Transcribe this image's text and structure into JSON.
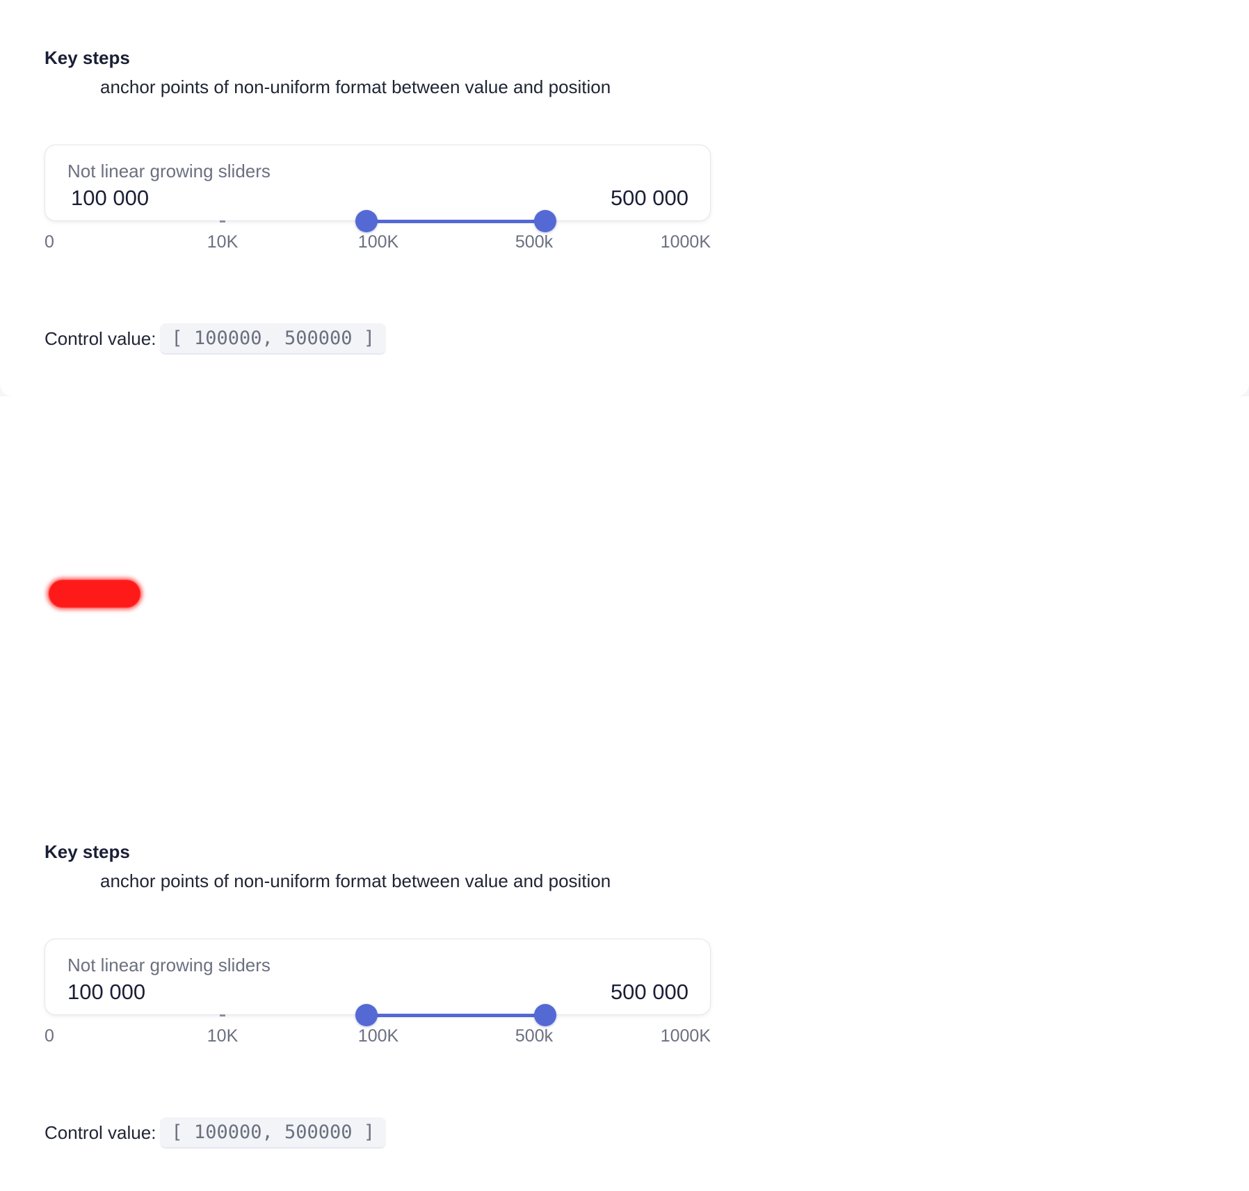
{
  "sections": [
    {
      "title": "Key steps",
      "subtitle": "anchor points of non-uniform format between value and position",
      "card_label": "Not linear growing sliders",
      "value_low": "100 000",
      "value_high": "500 000",
      "ticks": [
        "0",
        "10K",
        "100K",
        "500k",
        "1000K"
      ],
      "selected_range_tick_index": [
        2,
        3
      ],
      "control_label": "Control value:",
      "control_value": "[ 100000, 500000 ]"
    },
    {
      "title": "Key steps",
      "subtitle": "anchor points of non-uniform format between value and position",
      "card_label": "Not linear growing sliders",
      "value_low": "100 000",
      "value_high": "500 000",
      "ticks": [
        "0",
        "10K",
        "100K",
        "500k",
        "1000K"
      ],
      "selected_range_tick_index": [
        2,
        3
      ],
      "control_label": "Control value:",
      "control_value": "[ 100000, 500000 ]"
    }
  ],
  "error_badge": {
    "text": "",
    "color": "#ff1a1a"
  },
  "accent_color": "#5469d4"
}
